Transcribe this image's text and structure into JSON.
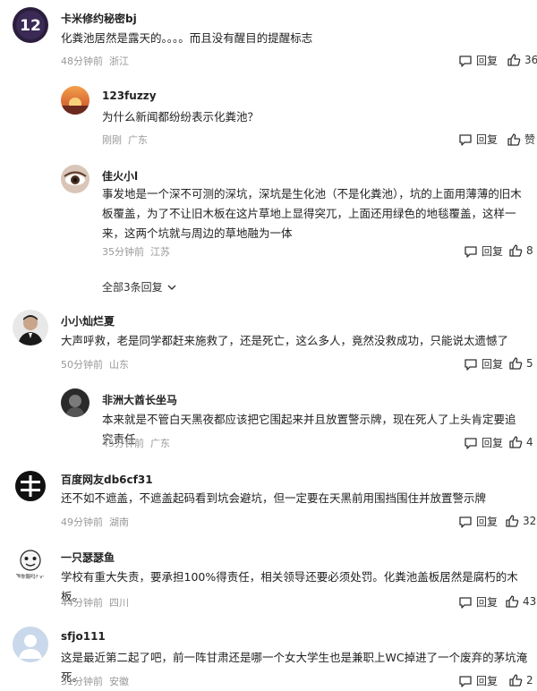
{
  "comments": [
    {
      "name": "卡米修约秘密bj",
      "text": "化粪池居然是露天的。。。。而且没有醒目的提醒标志",
      "time": "48分钟前",
      "location": "浙江",
      "reply": "回复",
      "likes": "36",
      "avatar_text": "12"
    },
    {
      "name": "123fuzzy",
      "text": "为什么新闻都纷纷表示化粪池？",
      "time": "刚刚",
      "location": "广东",
      "reply": "回复",
      "likes": "赞"
    },
    {
      "name": "佳火小l",
      "text": "事发地是一个深不可测的深坑，深坑是生化池（不是化粪池），坑的上面用薄薄的旧木板覆盖，为了不让旧木板在这片草地上显得突兀，上面还用绿色的地毯覆盖，这样一来，这两个坑就与周边的草地融为一体",
      "time": "35分钟前",
      "location": "江苏",
      "reply": "回复",
      "likes": "8"
    },
    {
      "name": "小小灿烂夏",
      "text": "大声呼救，老是同学都赶来施救了，还是死亡，这么多人，竟然没救成功，只能说太遗憾了",
      "time": "50分钟前",
      "location": "山东",
      "reply": "回复",
      "likes": "5"
    },
    {
      "name": "非洲大酋长坐马",
      "text": "本来就是不管白天黑夜都应该把它围起来并且放置警示牌，现在死人了上头肯定要追究责任",
      "time": "45分钟前",
      "location": "广东",
      "reply": "回复",
      "likes": "4"
    },
    {
      "name": "百度网友db6cf31",
      "text": "还不如不遮盖，不遮盖起码看到坑会避坑，但一定要在天黑前用围挡围住并放置警示牌",
      "time": "49分钟前",
      "location": "湖南",
      "reply": "回复",
      "likes": "32"
    },
    {
      "name": "一只瑟瑟鱼",
      "text": "学校有重大失责，要承担100%得责任，相关领导还要必须处罚。化粪池盖板居然是腐朽的木板。",
      "time": "44分钟前",
      "location": "四川",
      "reply": "回复",
      "likes": "43",
      "avatar_caption": "飞聊你服吗? yes!"
    },
    {
      "name": "sfjo111",
      "text": "这是最近第二起了吧，前一阵甘肃还是哪一个女大学生也是兼职上WC掉进了一个废弃的茅坑淹死。",
      "time": "31分钟前",
      "location": "安徽",
      "reply": "回复",
      "likes": "2"
    }
  ],
  "expand_replies": "全部3条回复",
  "colors": {
    "name": "#222222",
    "meta": "#999999",
    "text": "#222222"
  }
}
